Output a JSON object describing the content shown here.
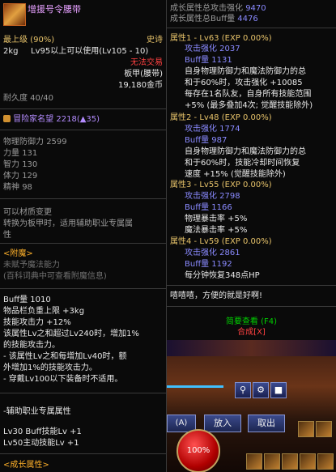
{
  "item": {
    "name": "增援号令腰带",
    "grade": "最上级 (90%)",
    "rarity": "史诗",
    "weight": "2kg",
    "level_req": "Lv95以上可以使用(Lv105 - 10)",
    "trade": "无法交易",
    "type": "板甲(腰带)",
    "price": "19,180金币",
    "durability": "耐久度 40/40",
    "fame_label": "冒险家名望",
    "fame_value": "2218(▲35)"
  },
  "stats": [
    {
      "label": "物理防御力",
      "value": "2599"
    },
    {
      "label": "力量",
      "value": "131"
    },
    {
      "label": "智力",
      "value": "130"
    },
    {
      "label": "体力",
      "value": "129"
    },
    {
      "label": "精神",
      "value": "98"
    }
  ],
  "transform": {
    "line1": "可以材质变更",
    "line2": "转换为板甲时，适用辅助职业专属属",
    "line3": "性"
  },
  "enchant": {
    "title": "<附魔>",
    "line1": "未赋予魔法能力",
    "line2": "(百科词典中可查看附魔信息)"
  },
  "buff": {
    "lines": [
      "Buff量 1010",
      "物品栏负重上限 +3kg",
      "技能攻击力 +12%",
      "该属性Lv之和超过Lv240时，增加1%",
      "的技能攻击力。",
      "- 该属性Lv之和每增加Lv40时，额",
      "外增加1%的技能攻击力。",
      "- 穿戴Lv100以下装备时不适用。"
    ]
  },
  "support": {
    "title": "-辅助职业专属属性",
    "line1": "Lv30 Buff技能Lv +1",
    "line2": "Lv50主动技能Lv +1"
  },
  "growth_footer": "<成长属性>",
  "right": {
    "total_attack_label": "成长属性总攻击强化",
    "total_attack_value": "9470",
    "total_buff_label": "成长属性总Buff量",
    "total_buff_value": "4476",
    "attrs": [
      {
        "title": "属性1 - Lv63 (EXP 0.00%)",
        "attack": "攻击强化 2037",
        "buff": "Buff量 1131",
        "desc": [
          "自身物理防御力和魔法防御力的总",
          "和于60%时，攻击强化 +10085",
          "每存在1名队友，自身所有技能范围",
          "+5% (最多叠加4次; 觉醒技能除外)"
        ]
      },
      {
        "title": "属性2 - Lv48 (EXP 0.00%)",
        "attack": "攻击强化 1774",
        "buff": "Buff量 987",
        "desc": [
          "自身物理防御力和魔法防御力的总",
          "和于60%时，技能冷却时间恢复",
          "速度 +15% (觉醒技能除外)"
        ]
      },
      {
        "title": "属性3 - Lv55 (EXP 0.00%)",
        "attack": "攻击强化 2798",
        "buff": "Buff量 1166",
        "desc": [
          "物理暴击率 +5%",
          "魔法暴击率 +5%"
        ]
      },
      {
        "title": "属性4 - Lv59 (EXP 0.00%)",
        "attack": "攻击强化 2861",
        "buff": "Buff量 1192",
        "desc": [
          "每分钟恢复348点HP"
        ]
      }
    ],
    "quote": "嘻嘻嘻，方便的就是好啊!",
    "brief_view": "简要查看 (F4)",
    "compose": "合成[X]"
  },
  "game": {
    "put_in": "放入",
    "withdraw": "取出",
    "hp": "100%",
    "key_a": "(A)"
  },
  "colors": {
    "item_name": "#e6a0ff",
    "rarity": "#e7c36a",
    "no_trade": "#ff4040",
    "attr_title": "#e7c36a",
    "attr_stat": "#8a8aff",
    "brief_view": "#00d000",
    "compose": "#ff4040"
  },
  "icons": [
    "belt-icon",
    "fame-icon",
    "search-icon",
    "gear-icon",
    "lock-icon"
  ]
}
